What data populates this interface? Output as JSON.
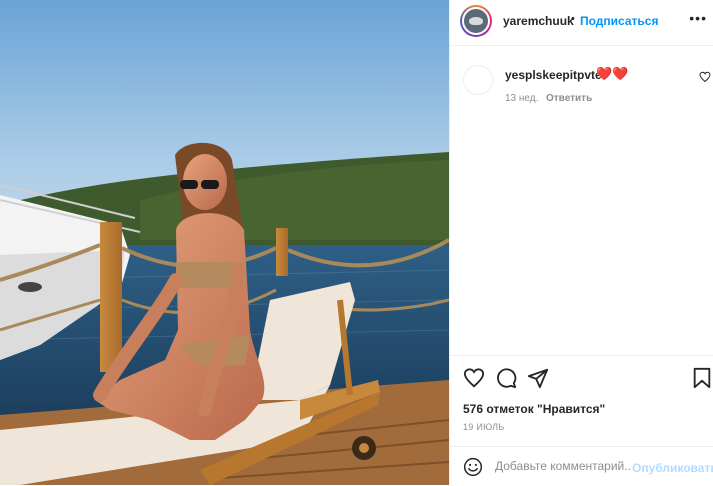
{
  "photo": {
    "alt": ""
  },
  "header": {
    "username": "yaremchuuk",
    "separator": "•",
    "follow_label": "Подписаться",
    "more_icon": "more-horizontal-icon",
    "more_glyph": "•••"
  },
  "comments": [
    {
      "username": "yesplskeepitpvte",
      "text": "❤️❤️",
      "time": "13 нед.",
      "reply_label": "Ответить"
    }
  ],
  "actions": {
    "like_icon": "heart-icon",
    "comment_icon": "comment-icon",
    "share_icon": "share-icon",
    "save_icon": "bookmark-icon"
  },
  "likes_text": "576 отметок \"Нравится\"",
  "date_text": "19 ИЮЛЬ",
  "composer": {
    "placeholder": "Добавьте комментарий...",
    "publish_label": "Опубликовать",
    "emoji_icon": "smiley-icon"
  },
  "colors": {
    "accent": "#0095f6",
    "publish_disabled": "#b3dbff",
    "heart": "#e01e2a",
    "text_primary": "#262626",
    "text_secondary": "#8e8e8e"
  }
}
